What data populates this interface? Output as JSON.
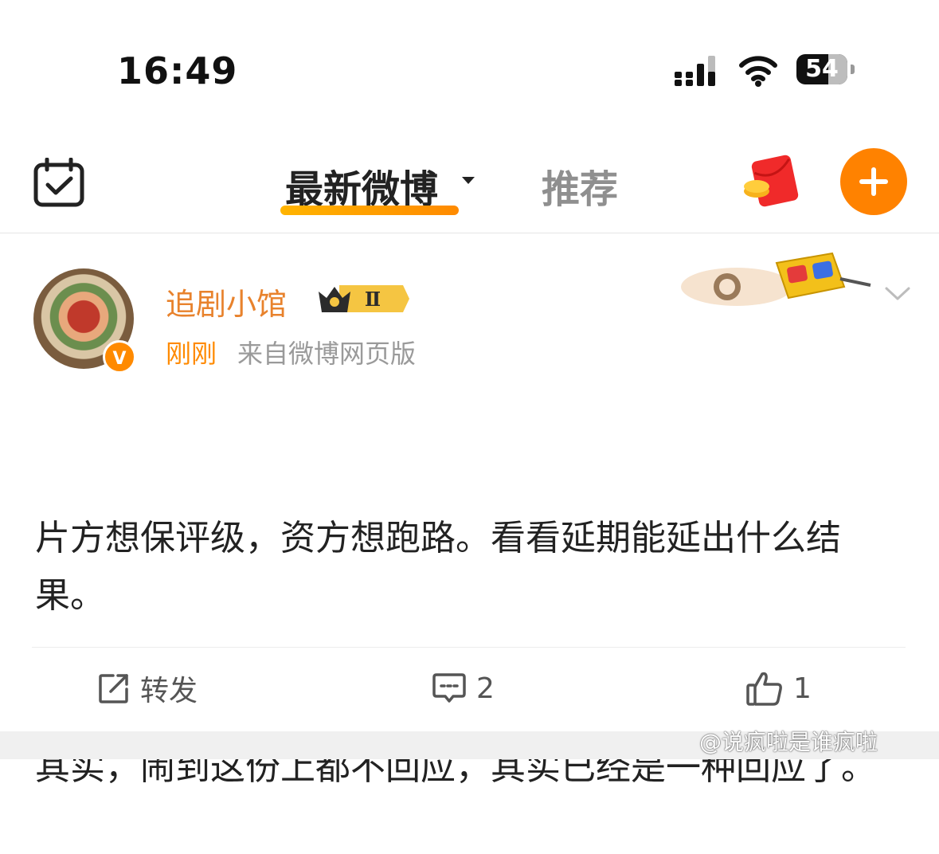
{
  "status_bar": {
    "time": "16:49",
    "battery": "54",
    "icons": [
      "cellular-signal-icon",
      "wifi-icon",
      "battery-icon"
    ]
  },
  "nav": {
    "tabs": [
      {
        "label": "最新微博",
        "active": true,
        "has_dropdown": true
      },
      {
        "label": "推荐",
        "active": false
      }
    ],
    "icons": [
      "checkin-calendar-icon",
      "red-packet-icon",
      "add-icon"
    ],
    "accent_color": "#ff8200"
  },
  "post": {
    "username": "追剧小馆",
    "vip_level": "Ⅱ",
    "verified_badge": "V",
    "time": "刚刚",
    "source": "来自微博网页版",
    "content_lines": [
      "片方想保评级，资方想跑路。看看延期能延出什么结果。",
      "其实，闹到这份上都不回应，其实已经是一种回应了。"
    ],
    "actions": {
      "repost": "转发",
      "comments": "2",
      "likes": "1"
    },
    "username_color": "#e8822c"
  },
  "watermark": "@说疯啦是谁疯啦"
}
